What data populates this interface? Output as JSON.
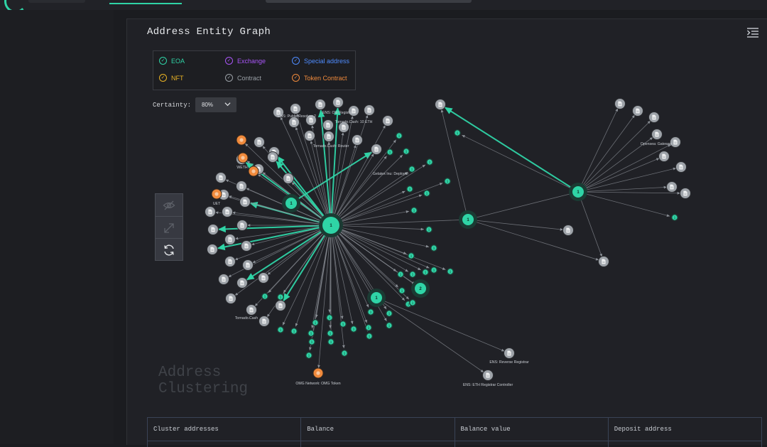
{
  "window": {
    "title": "Address Entity Graph"
  },
  "colors": {
    "eoa": "#2fd4a6",
    "exchange": "#a855f7",
    "special": "#4f8cff",
    "nft": "#e9b224",
    "contract": "#9aa0a6",
    "token_contract": "#f08a3c",
    "edge_default": "#8b9097",
    "edge_highlight": "#2fd4a6"
  },
  "legend": {
    "items": [
      {
        "label": "EOA",
        "color": "#2fd4a6"
      },
      {
        "label": "Exchange",
        "color": "#a855f7"
      },
      {
        "label": "Special address",
        "color": "#4f8cff"
      },
      {
        "label": "NFT",
        "color": "#e9b224"
      },
      {
        "label": "Contract",
        "color": "#9aa0a6"
      },
      {
        "label": "Token Contract",
        "color": "#f08a3c"
      }
    ]
  },
  "certainty": {
    "label": "Certainty:",
    "value": "80%"
  },
  "graph": {
    "hub_labels": [
      "1",
      "1",
      "1",
      "1",
      "2",
      "1"
    ],
    "node_labels": [
      "ENS: Public Resolver 2",
      "ENS: Old Registrar",
      "Tornado.Cash: 10 ETH",
      "Tornado.Cash: Router",
      "WETH",
      "UET",
      "Tornado.Cash",
      "Gelatex Inu: Deployer",
      "Opensea: Gateway",
      "ENS: Reverse Registrar",
      "ENS: ETH Registrar Controller",
      "OMG Network: OMG Token"
    ]
  },
  "tools": [
    {
      "name": "hide-icon"
    },
    {
      "name": "expand-icon"
    },
    {
      "name": "refresh-icon"
    }
  ],
  "watermark": {
    "line1": "Address",
    "line2": "Clustering"
  },
  "table": {
    "headers": [
      "Cluster addresses",
      "Balance",
      "Balance value",
      "Deposit address"
    ]
  }
}
